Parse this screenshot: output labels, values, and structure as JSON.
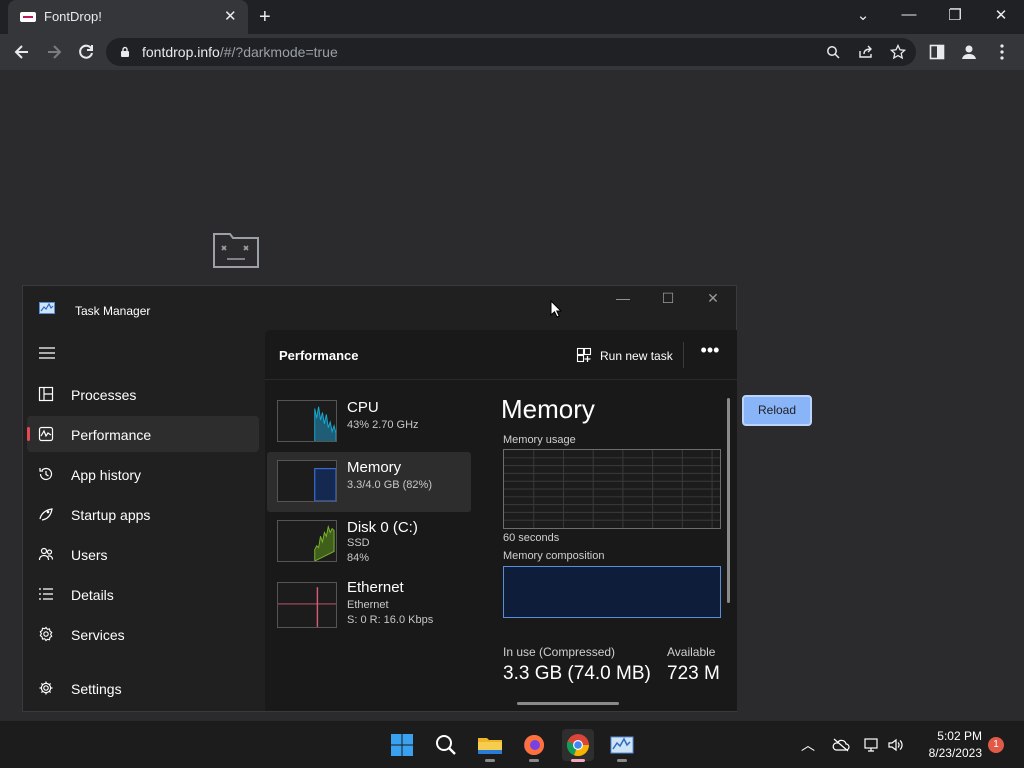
{
  "browser": {
    "tab_title": "FontDrop!",
    "tab_close": "✕",
    "new_tab": "+",
    "url_host": "fontdrop.info",
    "url_path": "/#/?darkmode=true",
    "window_controls": {
      "dropdown": "⌄",
      "minimize": "—",
      "restore": "❐",
      "close": "✕"
    }
  },
  "page": {
    "reload_label": "Reload"
  },
  "task_manager": {
    "title": "Task Manager",
    "controls": {
      "minimize": "—",
      "maximize": "☐",
      "close": "✕"
    },
    "nav": [
      {
        "label": "Processes",
        "icon": "processes-icon"
      },
      {
        "label": "Performance",
        "icon": "performance-icon",
        "selected": true
      },
      {
        "label": "App history",
        "icon": "app-history-icon"
      },
      {
        "label": "Startup apps",
        "icon": "startup-apps-icon"
      },
      {
        "label": "Users",
        "icon": "users-icon"
      },
      {
        "label": "Details",
        "icon": "details-icon"
      },
      {
        "label": "Services",
        "icon": "services-icon"
      }
    ],
    "settings_label": "Settings",
    "header": {
      "title": "Performance",
      "run_new_task": "Run new task",
      "more": "•••"
    },
    "resources": [
      {
        "name": "CPU",
        "line1": "43%  2.70 GHz",
        "line2": "",
        "color": "#17a8cf"
      },
      {
        "name": "Memory",
        "line1": "3.3/4.0 GB (82%)",
        "line2": "",
        "color": "#3a6fd8",
        "selected": true
      },
      {
        "name": "Disk 0 (C:)",
        "line1": "SSD",
        "line2": "84%",
        "color": "#7ab52e"
      },
      {
        "name": "Ethernet",
        "line1": "Ethernet",
        "line2": "S: 0  R: 16.0 Kbps",
        "color": "#d55a73"
      }
    ],
    "detail": {
      "heading": "Memory",
      "usage_label": "Memory usage",
      "seconds_label": "60 seconds",
      "composition_label": "Memory composition",
      "in_use_label": "In use (Compressed)",
      "in_use_value": "3.3 GB (74.0 MB)",
      "available_label": "Available",
      "available_value": "723 M"
    }
  },
  "taskbar": {
    "apps": [
      "start-icon",
      "search-icon",
      "file-explorer-icon",
      "firefox-icon",
      "chrome-icon",
      "task-manager-icon"
    ],
    "time": "5:02 PM",
    "date": "8/23/2023",
    "notification_count": "1"
  }
}
